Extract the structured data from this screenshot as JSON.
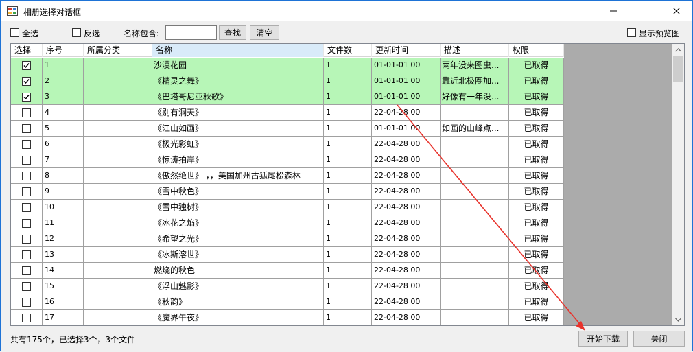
{
  "window": {
    "title": "相册选择对话框"
  },
  "colors": {
    "title_border": "#1e73d6",
    "selected_row": "#b7f6b7",
    "arrow": "#e8322b",
    "grid_empty": "#ababab"
  },
  "toolbar": {
    "select_all_label": "全选",
    "invert_label": "反选",
    "name_contains_label": "名称包含:",
    "search_value": "",
    "search_button": "查找",
    "clear_button": "清空",
    "show_preview_label": "显示预览图"
  },
  "table": {
    "headers": [
      "选择",
      "序号",
      "所属分类",
      "名称",
      "文件数",
      "更新时间",
      "描述",
      "权限"
    ],
    "rows": [
      {
        "checked": true,
        "no": "1",
        "category": "",
        "name": "沙漠花园",
        "files": "1",
        "updated": "01-01-01 00",
        "desc": "两年没来图虫...",
        "perm": "已取得"
      },
      {
        "checked": true,
        "no": "2",
        "category": "",
        "name": "《精灵之舞》",
        "files": "1",
        "updated": "01-01-01 00",
        "desc": "靠近北极圈加...",
        "perm": "已取得"
      },
      {
        "checked": true,
        "no": "3",
        "category": "",
        "name": "《巴塔哥尼亚秋歌》",
        "files": "1",
        "updated": "01-01-01 00",
        "desc": "好像有一年没...",
        "perm": "已取得"
      },
      {
        "checked": false,
        "no": "4",
        "category": "",
        "name": "《别有洞天》",
        "files": "1",
        "updated": "22-04-28 00",
        "desc": "",
        "perm": "已取得"
      },
      {
        "checked": false,
        "no": "5",
        "category": "",
        "name": "《江山如画》",
        "files": "1",
        "updated": "01-01-01 00",
        "desc": "如画的山峰点...",
        "perm": "已取得"
      },
      {
        "checked": false,
        "no": "6",
        "category": "",
        "name": "《极光彩虹》",
        "files": "1",
        "updated": "22-04-28 00",
        "desc": "",
        "perm": "已取得"
      },
      {
        "checked": false,
        "no": "7",
        "category": "",
        "name": "《惊涛拍岸》",
        "files": "1",
        "updated": "22-04-28 00",
        "desc": "",
        "perm": "已取得"
      },
      {
        "checked": false,
        "no": "8",
        "category": "",
        "name": "《傲然绝世》 ，，美国加州古狐尾松森林",
        "files": "1",
        "updated": "22-04-28 00",
        "desc": "",
        "perm": "已取得"
      },
      {
        "checked": false,
        "no": "9",
        "category": "",
        "name": "《雪中秋色》",
        "files": "1",
        "updated": "22-04-28 00",
        "desc": "",
        "perm": "已取得"
      },
      {
        "checked": false,
        "no": "10",
        "category": "",
        "name": "《雪中独树》",
        "files": "1",
        "updated": "22-04-28 00",
        "desc": "",
        "perm": "已取得"
      },
      {
        "checked": false,
        "no": "11",
        "category": "",
        "name": "《冰花之焰》",
        "files": "1",
        "updated": "22-04-28 00",
        "desc": "",
        "perm": "已取得"
      },
      {
        "checked": false,
        "no": "12",
        "category": "",
        "name": "《希望之光》",
        "files": "1",
        "updated": "22-04-28 00",
        "desc": "",
        "perm": "已取得"
      },
      {
        "checked": false,
        "no": "13",
        "category": "",
        "name": "《冰斯溶世》",
        "files": "1",
        "updated": "22-04-28 00",
        "desc": "",
        "perm": "已取得"
      },
      {
        "checked": false,
        "no": "14",
        "category": "",
        "name": "燃烧的秋色",
        "files": "1",
        "updated": "22-04-28 00",
        "desc": "",
        "perm": "已取得"
      },
      {
        "checked": false,
        "no": "15",
        "category": "",
        "name": "《浮山魅影》",
        "files": "1",
        "updated": "22-04-28 00",
        "desc": "",
        "perm": "已取得"
      },
      {
        "checked": false,
        "no": "16",
        "category": "",
        "name": "《秋韵》",
        "files": "1",
        "updated": "22-04-28 00",
        "desc": "",
        "perm": "已取得"
      },
      {
        "checked": false,
        "no": "17",
        "category": "",
        "name": "《魔界午夜》",
        "files": "1",
        "updated": "22-04-28 00",
        "desc": "",
        "perm": "已取得"
      }
    ]
  },
  "status": {
    "text": "共有175个，已选择3个，3个文件"
  },
  "footer": {
    "download_button": "开始下载",
    "close_button": "关闭"
  }
}
